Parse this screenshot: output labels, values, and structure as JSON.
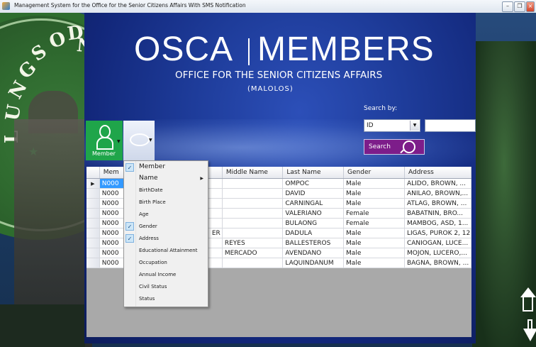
{
  "window": {
    "title": "Management System for the Office for the Senior Citizens Affairs With SMS Notification"
  },
  "background": {
    "seal_letters": [
      "L",
      "U",
      "N",
      "G",
      "S",
      "O",
      "D",
      "N"
    ]
  },
  "header": {
    "brand_left": "OSCA",
    "brand_right": "MEMBERS",
    "subtitle": "OFFICE FOR THE SENIOR CITIZENS AFFAIRS",
    "place": "(MALOLOS)"
  },
  "search": {
    "label": "Search by:",
    "field": "ID",
    "button_label": "Search"
  },
  "toolbar": {
    "member_label": "Member"
  },
  "grid": {
    "columns": [
      "Mem",
      "Middle Name",
      "Last Name",
      "Gender",
      "Address"
    ],
    "rows": [
      {
        "id": "N000",
        "col2": "",
        "middle": "",
        "last": "OMPOC",
        "gender": "Male",
        "address": "ALIDO, BROWN, ..."
      },
      {
        "id": "N000",
        "col2": "",
        "middle": "",
        "last": "DAVID",
        "gender": "Male",
        "address": "ANILAO, BROWN,..."
      },
      {
        "id": "N000",
        "col2": "",
        "middle": "",
        "last": "CARNINGAL",
        "gender": "Male",
        "address": "ATLAG, BROWN, ..."
      },
      {
        "id": "N000",
        "col2": "",
        "middle": "",
        "last": "VALERIANO",
        "gender": "Female",
        "address": "BABATNIN, BRO..."
      },
      {
        "id": "N000",
        "col2": "",
        "middle": "",
        "last": "BULAONG",
        "gender": "Female",
        "address": "MAMBOG, ASD, 1..."
      },
      {
        "id": "N000",
        "col2": "ER",
        "middle": "",
        "last": "DADULA",
        "gender": "Male",
        "address": "LIGAS, PUROK 2, 12"
      },
      {
        "id": "N000",
        "col2": "",
        "middle": "REYES",
        "last": "BALLESTEROS",
        "gender": "Male",
        "address": "CANIOGAN, LUCE..."
      },
      {
        "id": "N000",
        "col2": "",
        "middle": "MERCADO",
        "last": "AVENDANO",
        "gender": "Male",
        "address": "MOJON, LUCERO,..."
      },
      {
        "id": "N000",
        "col2": "",
        "middle": "",
        "last": "LAQUINDANUM",
        "gender": "Male",
        "address": "BAGNA, BROWN, ..."
      }
    ]
  },
  "menu": {
    "items": [
      {
        "label": "Member",
        "checked": true
      },
      {
        "label": "Name",
        "submenu": true
      },
      {
        "label": "BirthDate"
      },
      {
        "label": "Birth Place"
      },
      {
        "label": "Age"
      },
      {
        "label": "Gender",
        "checked": true
      },
      {
        "label": "Address",
        "checked": true
      },
      {
        "label": "Educational Attainment"
      },
      {
        "label": "Occupation"
      },
      {
        "label": "Annual Income"
      },
      {
        "label": "Civil Status"
      },
      {
        "label": "Status"
      }
    ]
  }
}
